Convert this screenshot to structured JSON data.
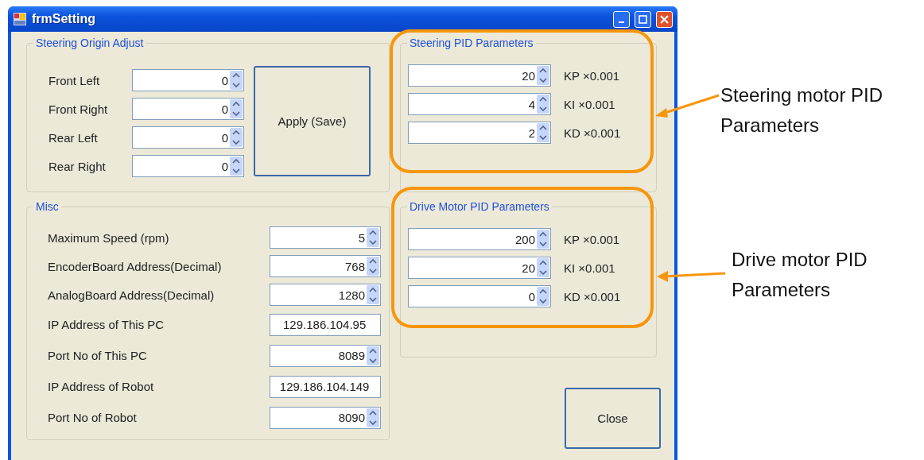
{
  "window": {
    "title": "frmSetting"
  },
  "steering_origin": {
    "title": "Steering Origin Adjust",
    "apply_button": "Apply (Save)",
    "fields": [
      {
        "label": "Front Left",
        "value": "0"
      },
      {
        "label": "Front Right",
        "value": "0"
      },
      {
        "label": "Rear Left",
        "value": "0"
      },
      {
        "label": "Rear Right",
        "value": "0"
      }
    ]
  },
  "misc": {
    "title": "Misc",
    "fields": [
      {
        "label": "Maximum Speed (rpm)",
        "value": "5",
        "kind": "spin"
      },
      {
        "label": "EncoderBoard Address(Decimal)",
        "value": "768",
        "kind": "spin"
      },
      {
        "label": "AnalogBoard Address(Decimal)",
        "value": "1280",
        "kind": "spin"
      },
      {
        "label": "IP Address of This PC",
        "value": "129.186.104.95",
        "kind": "text"
      },
      {
        "label": "Port No of This PC",
        "value": "8089",
        "kind": "spin"
      },
      {
        "label": "IP Address of Robot",
        "value": "129.186.104.149",
        "kind": "text"
      },
      {
        "label": "Port No of Robot",
        "value": "8090",
        "kind": "spin"
      }
    ]
  },
  "steering_pid": {
    "title": "Steering PID Parameters",
    "fields": [
      {
        "value": "20",
        "unit": "KP ×0.001"
      },
      {
        "value": "4",
        "unit": "KI ×0.001"
      },
      {
        "value": "2",
        "unit": "KD ×0.001"
      }
    ]
  },
  "drive_pid": {
    "title": "Drive Motor PID Parameters",
    "fields": [
      {
        "value": "200",
        "unit": "KP ×0.001"
      },
      {
        "value": "20",
        "unit": "KI ×0.001"
      },
      {
        "value": "0",
        "unit": "KD ×0.001"
      }
    ]
  },
  "close_button": "Close",
  "annotations": [
    {
      "text": "Steering motor PID Parameters"
    },
    {
      "text": "Drive motor PID Parameters"
    }
  ]
}
